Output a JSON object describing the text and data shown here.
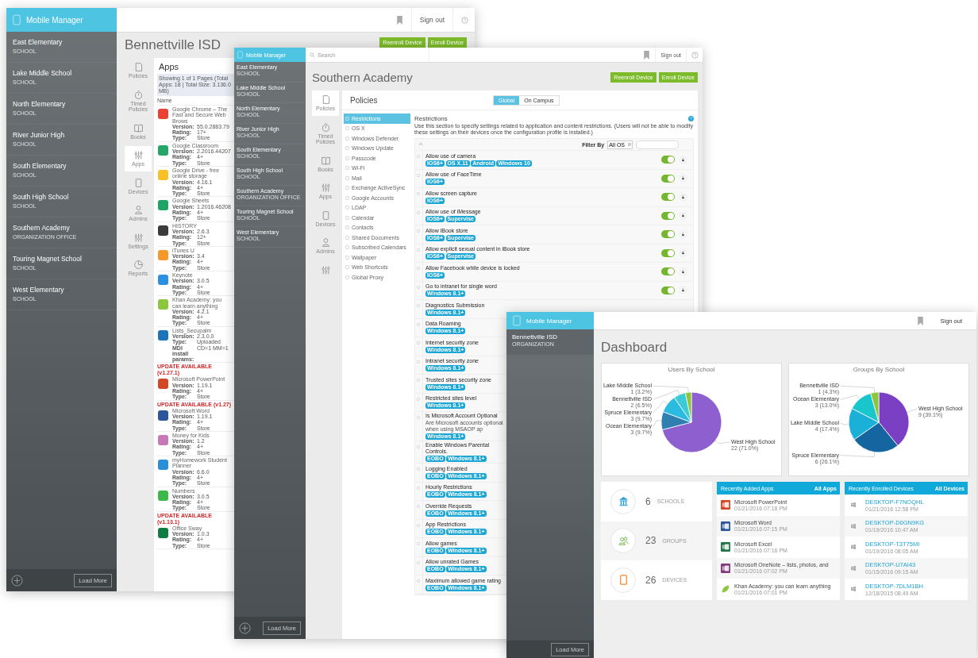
{
  "back_window": {
    "brand": "Mobile Manager",
    "sidebar": [
      {
        "name": "East Elementary",
        "type": "SCHOOL"
      },
      {
        "name": "Lake Middle School",
        "type": "SCHOOL"
      },
      {
        "name": "North Elementary",
        "type": "SCHOOL"
      },
      {
        "name": "River Junior High",
        "type": "SCHOOL"
      },
      {
        "name": "South Elementary",
        "type": "SCHOOL"
      },
      {
        "name": "South High School",
        "type": "SCHOOL"
      },
      {
        "name": "Southern Academy",
        "type": "ORGANIZATION OFFICE"
      },
      {
        "name": "Touring Magnet School",
        "type": "SCHOOL"
      },
      {
        "name": "West Elementary",
        "type": "SCHOOL"
      }
    ],
    "sign_out": "Sign out",
    "title": "Bennettville ISD",
    "actions": [
      "Reenroll Device",
      "Enroll Device"
    ],
    "nav": [
      {
        "label": "Policies",
        "selected": false
      },
      {
        "label": "Timed Policies",
        "selected": false
      },
      {
        "label": "Books",
        "selected": false
      },
      {
        "label": "Apps",
        "selected": true
      },
      {
        "label": "Devices",
        "selected": false
      },
      {
        "label": "Admins",
        "selected": false
      },
      {
        "label": "Settings",
        "selected": false
      },
      {
        "label": "Reports",
        "selected": false
      }
    ],
    "apps_panel": {
      "heading": "Apps",
      "summary": "Showing 1 of 1 Pages (Total Apps: 18 | Total Size: 3.136.0 MB)",
      "column": "Name",
      "apps": [
        {
          "name": "Google Chrome – The Fast and Secure Web Brows",
          "color": "#e94235",
          "fields": [
            {
              "label": "Version:",
              "value": "55.0.2883.79"
            },
            {
              "label": "Rating:",
              "value": "17+"
            },
            {
              "label": "Type:",
              "value": "Store"
            }
          ]
        },
        {
          "name": "Google Classroom",
          "color": "#25a667",
          "fields": [
            {
              "label": "Version:",
              "value": "2.2016.44207"
            },
            {
              "label": "Rating:",
              "value": "4+"
            },
            {
              "label": "Type:",
              "value": "Store"
            }
          ]
        },
        {
          "name": "Google Drive - free online storage",
          "color": "#f6c026",
          "fields": [
            {
              "label": "Version:",
              "value": "4.16.1"
            },
            {
              "label": "Rating:",
              "value": "4+"
            },
            {
              "label": "Type:",
              "value": "Store"
            }
          ]
        },
        {
          "name": "Google Sheets",
          "color": "#20a464",
          "fields": [
            {
              "label": "Version:",
              "value": "1.2016.46208"
            },
            {
              "label": "Rating:",
              "value": "4+"
            },
            {
              "label": "Type:",
              "value": "Store"
            }
          ]
        },
        {
          "name": "HISTORY",
          "color": "#3a3a3a",
          "fields": [
            {
              "label": "Version:",
              "value": "2.6.3"
            },
            {
              "label": "Rating:",
              "value": "12+"
            },
            {
              "label": "Type:",
              "value": "Store"
            }
          ]
        },
        {
          "name": "iTunes U",
          "color": "#f39a2b",
          "fields": [
            {
              "label": "Version:",
              "value": "3.4"
            },
            {
              "label": "Rating:",
              "value": "4+"
            },
            {
              "label": "Type:",
              "value": "Store"
            }
          ]
        },
        {
          "name": "Keynote",
          "color": "#2d8fe0",
          "fields": [
            {
              "label": "Version:",
              "value": "3.0.5"
            },
            {
              "label": "Rating:",
              "value": "4+"
            },
            {
              "label": "Type:",
              "value": "Store"
            }
          ]
        },
        {
          "name": "Khan Academy: you can learn anything",
          "color": "#8cc63f",
          "fields": [
            {
              "label": "Version:",
              "value": "4.2.1"
            },
            {
              "label": "Rating:",
              "value": "4+"
            },
            {
              "label": "Type:",
              "value": "Store"
            }
          ]
        },
        {
          "name": "Lists_Secupalm",
          "color": "#1f73b7",
          "fields": [
            {
              "label": "Version:",
              "value": "2.3.0.0"
            },
            {
              "label": "Type:",
              "value": "Uploaded"
            },
            {
              "label": "MDI install params:",
              "value": "CD=1 MM=1"
            }
          ]
        },
        {
          "update": "UPDATE AVAILABLE (v1.27.1)",
          "name": "Microsoft PowerPoint",
          "color": "#d24726",
          "fields": [
            {
              "label": "Version:",
              "value": "1.19.1"
            },
            {
              "label": "Rating:",
              "value": "4+"
            },
            {
              "label": "Type:",
              "value": "Store"
            }
          ]
        },
        {
          "update": "UPDATE AVAILABLE (v1.27)",
          "name": "Microsoft Word",
          "color": "#2b579a",
          "fields": [
            {
              "label": "Version:",
              "value": "1.19.1"
            },
            {
              "label": "Rating:",
              "value": "4+"
            },
            {
              "label": "Type:",
              "value": "Store"
            }
          ]
        },
        {
          "name": "Money for Kids",
          "color": "#c878b8",
          "fields": [
            {
              "label": "Version:",
              "value": "1.2"
            },
            {
              "label": "Rating:",
              "value": "4+"
            },
            {
              "label": "Type:",
              "value": "Store"
            }
          ]
        },
        {
          "name": "myHomework Student Planner",
          "color": "#2c8ed6",
          "fields": [
            {
              "label": "Version:",
              "value": "6.6.0"
            },
            {
              "label": "Rating:",
              "value": "4+"
            },
            {
              "label": "Type:",
              "value": "Store"
            }
          ]
        },
        {
          "name": "Numbers",
          "color": "#3cb94a",
          "fields": [
            {
              "label": "Version:",
              "value": "3.0.5"
            },
            {
              "label": "Rating:",
              "value": "4+"
            },
            {
              "label": "Type:",
              "value": "Store"
            }
          ]
        },
        {
          "update": "UPDATE AVAILABLE (v1.13.1)",
          "name": "Office Sway",
          "color": "#107c41",
          "fields": [
            {
              "label": "Version:",
              "value": "1.0.3"
            },
            {
              "label": "Rating:",
              "value": "4+"
            },
            {
              "label": "Type:",
              "value": "Store"
            }
          ]
        }
      ]
    },
    "load_more": "Load More"
  },
  "middle_window": {
    "brand": "Mobile Manager",
    "search": {
      "placeholder": "Search"
    },
    "sidebar": [
      {
        "name": "East Elementary",
        "type": "SCHOOL"
      },
      {
        "name": "Lake Middle School",
        "type": "SCHOOL"
      },
      {
        "name": "North Elementary",
        "type": "SCHOOL"
      },
      {
        "name": "River Junior High",
        "type": "SCHOOL"
      },
      {
        "name": "South Elementary",
        "type": "SCHOOL"
      },
      {
        "name": "South High School",
        "type": "SCHOOL"
      },
      {
        "name": "Southern Academy",
        "type": "ORGANIZATION OFFICE"
      },
      {
        "name": "Touring Magnet School",
        "type": "SCHOOL"
      },
      {
        "name": "West Elementary",
        "type": "SCHOOL"
      }
    ],
    "sign_out": "Sign out",
    "title": "Southern Academy",
    "actions": [
      "Reenroll Device",
      "Enroll Device"
    ],
    "nav": [
      {
        "label": "Policies",
        "selected": true
      },
      {
        "label": "Timed Policies",
        "selected": false
      },
      {
        "label": "Books",
        "selected": false
      },
      {
        "label": "Apps",
        "selected": false
      },
      {
        "label": "Devices",
        "selected": false
      },
      {
        "label": "Admins",
        "selected": false
      },
      {
        "selected": false
      }
    ],
    "policies": {
      "heading": "Policies",
      "scopes": [
        {
          "label": "Global",
          "selected": true
        },
        {
          "label": "On Campus",
          "selected": false
        }
      ],
      "categories": [
        {
          "label": "Restrictions",
          "selected": true
        },
        {
          "label": "OS X",
          "selected": false
        },
        {
          "label": "Windows Defender",
          "selected": false
        },
        {
          "label": "Windows Update",
          "selected": false
        },
        {
          "label": "Passcode",
          "selected": false
        },
        {
          "label": "Wi-Fi",
          "selected": false
        },
        {
          "label": "Mail",
          "selected": false
        },
        {
          "label": "Exchange ActiveSync",
          "selected": false
        },
        {
          "label": "Google Accounts",
          "selected": false
        },
        {
          "label": "LDAP",
          "selected": false
        },
        {
          "label": "Calendar",
          "selected": false
        },
        {
          "label": "Contacts",
          "selected": false
        },
        {
          "label": "Shared Documents",
          "selected": false
        },
        {
          "label": "Subscribed Calendars",
          "selected": false
        },
        {
          "label": "Wallpaper",
          "selected": false
        },
        {
          "label": "Web Shortcuts",
          "selected": false
        },
        {
          "label": "Global Proxy",
          "selected": false
        }
      ],
      "section": {
        "heading": "Restrictions",
        "description": "Use this section to specify settings related to application and content restrictions. (Users will not be able to modify these settings on their devices once the configuration profile is installed.)",
        "filter_label": "Filter By",
        "filter_value": "All OS",
        "rows": [
          {
            "title": "Allow use of camera",
            "tags": [
              "IOS6+",
              "OS X.11",
              "Android",
              "Windows 10"
            ],
            "on": true
          },
          {
            "title": "Allow use of FaceTime",
            "tags": [
              "IOS6+"
            ],
            "on": true
          },
          {
            "title": "Allow screen capture",
            "tags": [
              "IOS6+"
            ],
            "on": true
          },
          {
            "title": "Allow use of iMessage",
            "tags": [
              "IOS6+",
              "Supervise"
            ],
            "on": true
          },
          {
            "title": "Allow iBook store",
            "tags": [
              "IOS6+",
              "Supervise"
            ],
            "on": true
          },
          {
            "title": "Allow explicit sexual content in iBook store",
            "tags": [
              "IOS6+",
              "Supervise"
            ],
            "on": true
          },
          {
            "title": "Allow Facebook while device is locked",
            "tags": [
              "IOS6+"
            ],
            "on": true
          },
          {
            "title": "Go to intranet for single word",
            "tags": [
              "Windows 8.1+"
            ],
            "on": true
          },
          {
            "title": "Diagnostics Submission",
            "tags": [
              "Windows 8.1+"
            ]
          },
          {
            "title": "Data Roaming",
            "tags": [
              "Windows 8.1+"
            ]
          },
          {
            "title": "Internet security zone",
            "tags": [
              "Windows 8.1+"
            ]
          },
          {
            "title": "Intranet security zone",
            "tags": [
              "Windows 8.1+"
            ]
          },
          {
            "title": "Trusted sites security zone",
            "tags": [
              "Windows 8.1+"
            ]
          },
          {
            "title": "Restricted sites level",
            "tags": [
              "Windows 8.1+"
            ]
          },
          {
            "title": "Is Microsoft Account Optional",
            "subtitle": "Are Microsoft accounts optional when using MSAOP ap",
            "tags": [
              "Windows 8.1+"
            ]
          },
          {
            "title": "Enable Windows Parental Controls.",
            "tags": [
              "EOBO",
              "Windows 8.1+"
            ]
          },
          {
            "title": "Logging Enabled",
            "tags": [
              "EOBO",
              "Windows 8.1+"
            ]
          },
          {
            "title": "Hourly Restrictions",
            "tags": [
              "EOBO",
              "Windows 8.1+"
            ]
          },
          {
            "title": "Override Requests",
            "tags": [
              "EOBO",
              "Windows 8.1+"
            ]
          },
          {
            "title": "App Restrictions",
            "tags": [
              "EOBO",
              "Windows 8.1+"
            ]
          },
          {
            "title": "Allow games",
            "tags": [
              "EOBO",
              "Windows 8.1+"
            ]
          },
          {
            "title": "Allow unrated Games",
            "tags": [
              "EOBO",
              "Windows 8.1+"
            ]
          },
          {
            "title": "Maximum allowed game rating",
            "tags": [
              "EOBO",
              "Windows 8.1+"
            ]
          }
        ]
      }
    },
    "load_more": "Load More"
  },
  "front_window": {
    "brand": "Mobile Manager",
    "sidebar": [
      {
        "name": "Bennettville ISD",
        "type": "ORGANIZATION"
      }
    ],
    "sign_out": "Sign out",
    "title": "Dashboard",
    "charts": [
      {
        "chart_data": {
          "type": "pie",
          "title": "Users By School",
          "categories": [
            "West High School",
            "Ocean Elementary",
            "Spruce Elementary",
            "Bennettville ISD",
            "Lake Middle School"
          ],
          "values": [
            22,
            3,
            3,
            2,
            1
          ],
          "data_labels": true,
          "value_labels": [
            "22 (71.0%)",
            "3 (9.7%)",
            "3 (9.7%)",
            "2 (6.5%)",
            "1 (3.2%)"
          ]
        }
      },
      {
        "chart_data": {
          "type": "pie",
          "title": "Groups By School",
          "categories": [
            "West High School",
            "Spruce Elementary",
            "Lake Middle School",
            "Ocean Elementary",
            "Bennettville ISD"
          ],
          "values": [
            9,
            6,
            4,
            3,
            1
          ],
          "data_labels": true,
          "value_labels": [
            "9 (39.1%)",
            "6 (26.1%)",
            "4 (17.4%)",
            "3 (13.0%)",
            "1 (4.3%)"
          ]
        }
      }
    ],
    "stats": [
      {
        "kind": "schools",
        "count": "6",
        "label": "SCHOOLS"
      },
      {
        "kind": "groups",
        "count": "23",
        "label": "GROUPS"
      },
      {
        "kind": "devices",
        "count": "26",
        "label": "DEVICES"
      }
    ],
    "recent_apps": {
      "heading": "Recently Added Apps",
      "link": "All Apps",
      "items": [
        {
          "kind": "tile",
          "color": "#d24726",
          "name": "Microsoft PowerPoint",
          "date": "01/21/2016 07:18 PM"
        },
        {
          "kind": "tile",
          "color": "#2b579a",
          "name": "Microsoft Word",
          "date": "01/21/2016 07:15 PM"
        },
        {
          "kind": "tile",
          "color": "#217346",
          "name": "Microsoft Excel",
          "date": "01/21/2016 07:16 PM"
        },
        {
          "kind": "tile",
          "color": "#80397b",
          "name": "Microsoft OneNote – lists, photos, and",
          "date": "01/21/2016 07:02 PM"
        },
        {
          "kind": "leaf",
          "color": "#8cc63f",
          "name": "Khan Academy: you can learn anything",
          "date": "01/21/2016 07:01 PM"
        }
      ]
    },
    "recent_devices": {
      "heading": "Recently Enrolled Devices",
      "link": "All Devices",
      "items": [
        {
          "name": "DESKTOP-F7NOQHL",
          "date": "01/21/2016 12:58 PM"
        },
        {
          "name": "DESKTOP-D0GN9KG",
          "date": "01/19/2016 10:47 AM"
        },
        {
          "name": "DESKTOP-T3T75MI",
          "date": "01/19/2016 08:05 AM"
        },
        {
          "name": "DESKTOP-U7AI43",
          "date": "01/15/2016 09:15 AM"
        },
        {
          "name": "DESKTOP-7DLM1BH",
          "date": "12/18/2015 08:49 AM"
        }
      ]
    },
    "load_more": "Load More"
  }
}
